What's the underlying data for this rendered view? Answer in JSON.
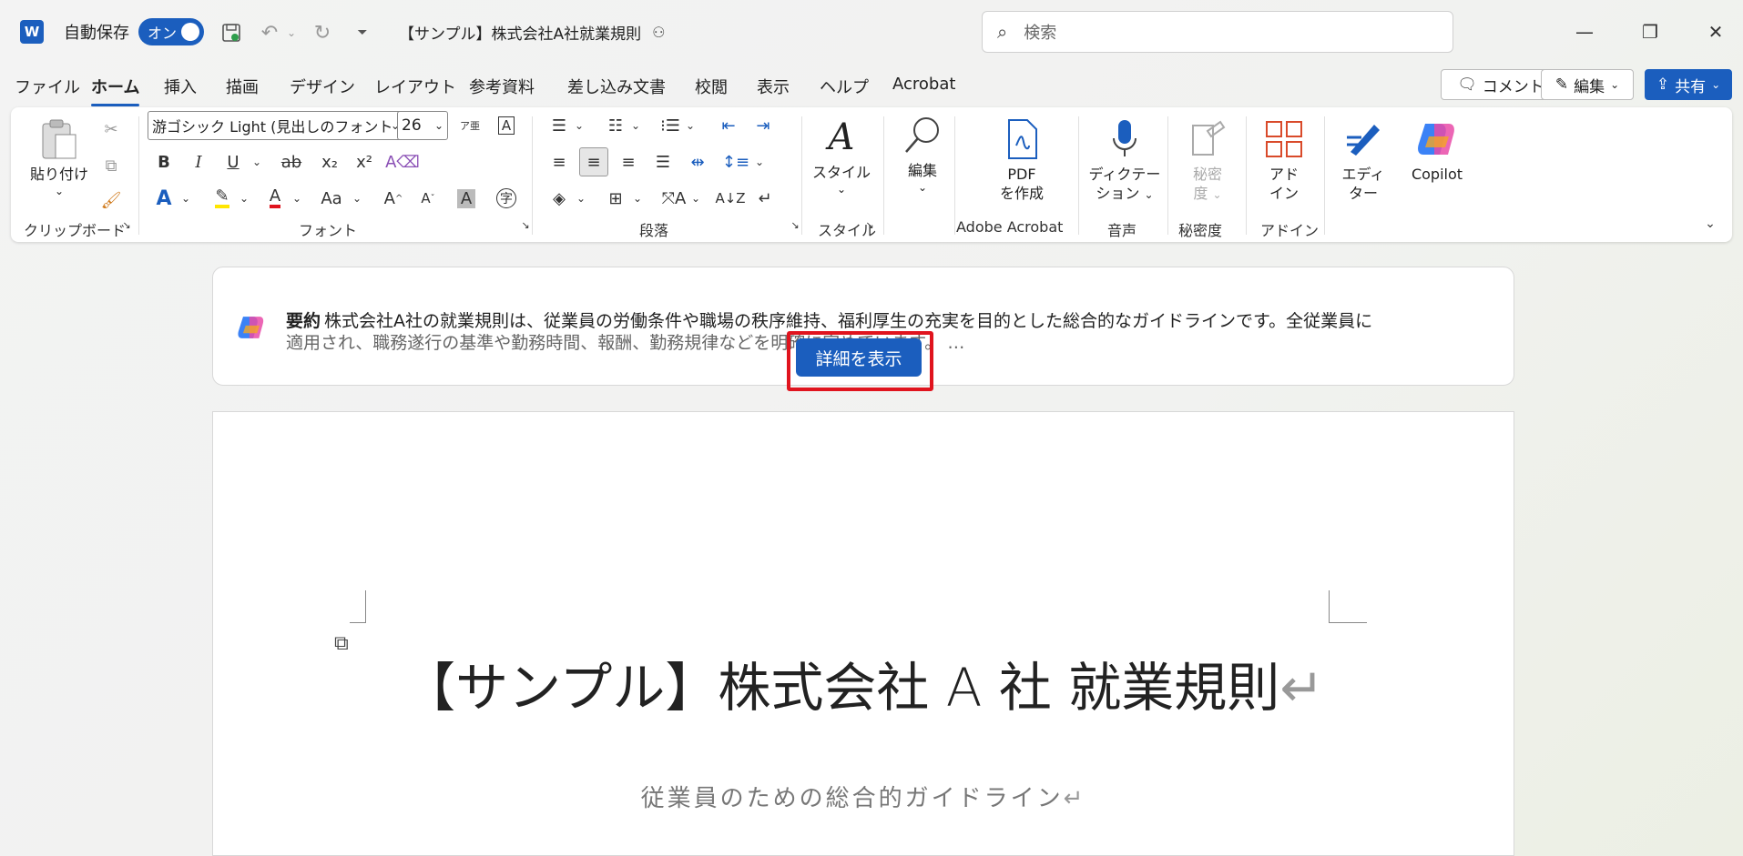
{
  "titlebar": {
    "app_logo": "W",
    "autosave_label": "自動保存",
    "autosave_state": "オン",
    "doc_title": "【サンプル】株式会社A社就業規則",
    "search_placeholder": "検索",
    "icons": [
      "save-icon",
      "undo-icon",
      "redo-icon",
      "customize-icon",
      "minimize-icon",
      "restore-icon",
      "close-icon"
    ]
  },
  "tabs": [
    "ファイル",
    "ホーム",
    "挿入",
    "描画",
    "デザイン",
    "レイアウト",
    "参考資料",
    "差し込み文書",
    "校閲",
    "表示",
    "ヘルプ",
    "Acrobat"
  ],
  "active_tab": "ホーム",
  "top_buttons": {
    "comment": "コメント",
    "edit": "編集",
    "share": "共有"
  },
  "ribbon": {
    "clipboard": {
      "paste": "貼り付け",
      "label": "クリップボード"
    },
    "font": {
      "name": "游ゴシック Light (見出しのフォント",
      "size": "26",
      "label": "フォント",
      "bold": "B",
      "italic": "I",
      "underline": "U",
      "strike": "ab",
      "sub": "x₂",
      "sup": "x²",
      "case": "Aa"
    },
    "paragraph": {
      "label": "段落"
    },
    "styles": {
      "button": "スタイル",
      "label": "スタイル"
    },
    "editing": {
      "button": "編集"
    },
    "acrobat": {
      "button_line1": "PDF",
      "button_line2": "を作成",
      "label": "Adobe Acrobat"
    },
    "voice": {
      "button_line1": "ディクテー",
      "button_line2": "ション",
      "label": "音声"
    },
    "sensitivity": {
      "button_line1": "秘密",
      "button_line2": "度",
      "label": "秘密度"
    },
    "addins": {
      "button_line1": "アド",
      "button_line2": "イン",
      "label": "アドイン"
    },
    "editor": {
      "button_line1": "エディ",
      "button_line2": "ター"
    },
    "copilot": {
      "button": "Copilot"
    }
  },
  "summary": {
    "heading": "要約",
    "line1": "株式会社A社の就業規則は、従業員の労働条件や職場の秩序維持、福利厚生の充実を目的とした総合的なガイドラインです。全従業員に",
    "line2": "適用され、職務遂行の基準や勤務時間、報酬、勤務規律などを明確に定めています。 …",
    "detail_button": "詳細を表示"
  },
  "document": {
    "title": "【サンプル】株式会社 A 社  就業規則",
    "subtitle": "従業員のための総合的ガイドライン",
    "return_mark": "↵"
  }
}
